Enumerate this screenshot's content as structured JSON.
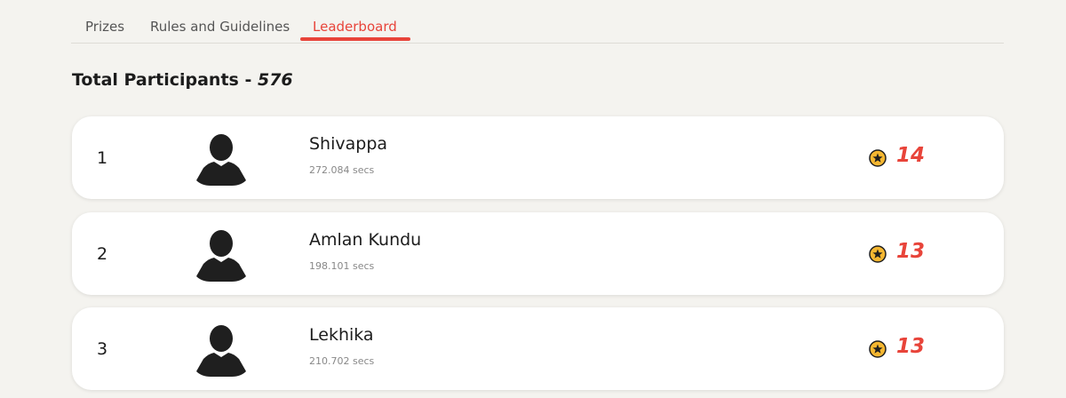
{
  "tabs": [
    {
      "label": "Prizes",
      "active": false
    },
    {
      "label": "Rules and Guidelines",
      "active": false
    },
    {
      "label": "Leaderboard",
      "active": true
    }
  ],
  "summary": {
    "label": "Total Participants - ",
    "count": "576"
  },
  "leaderboard": [
    {
      "rank": "1",
      "name": "Shivappa",
      "time": "272.084 secs",
      "score": "14"
    },
    {
      "rank": "2",
      "name": "Amlan Kundu",
      "time": "198.101 secs",
      "score": "13"
    },
    {
      "rank": "3",
      "name": "Lekhika",
      "time": "210.702 secs",
      "score": "13"
    }
  ],
  "colors": {
    "accent": "#e8443a",
    "background": "#f4f3ef",
    "coin": "#f5b731"
  },
  "icons": {
    "avatar": "user-silhouette-icon",
    "coin": "star-coin-icon"
  }
}
